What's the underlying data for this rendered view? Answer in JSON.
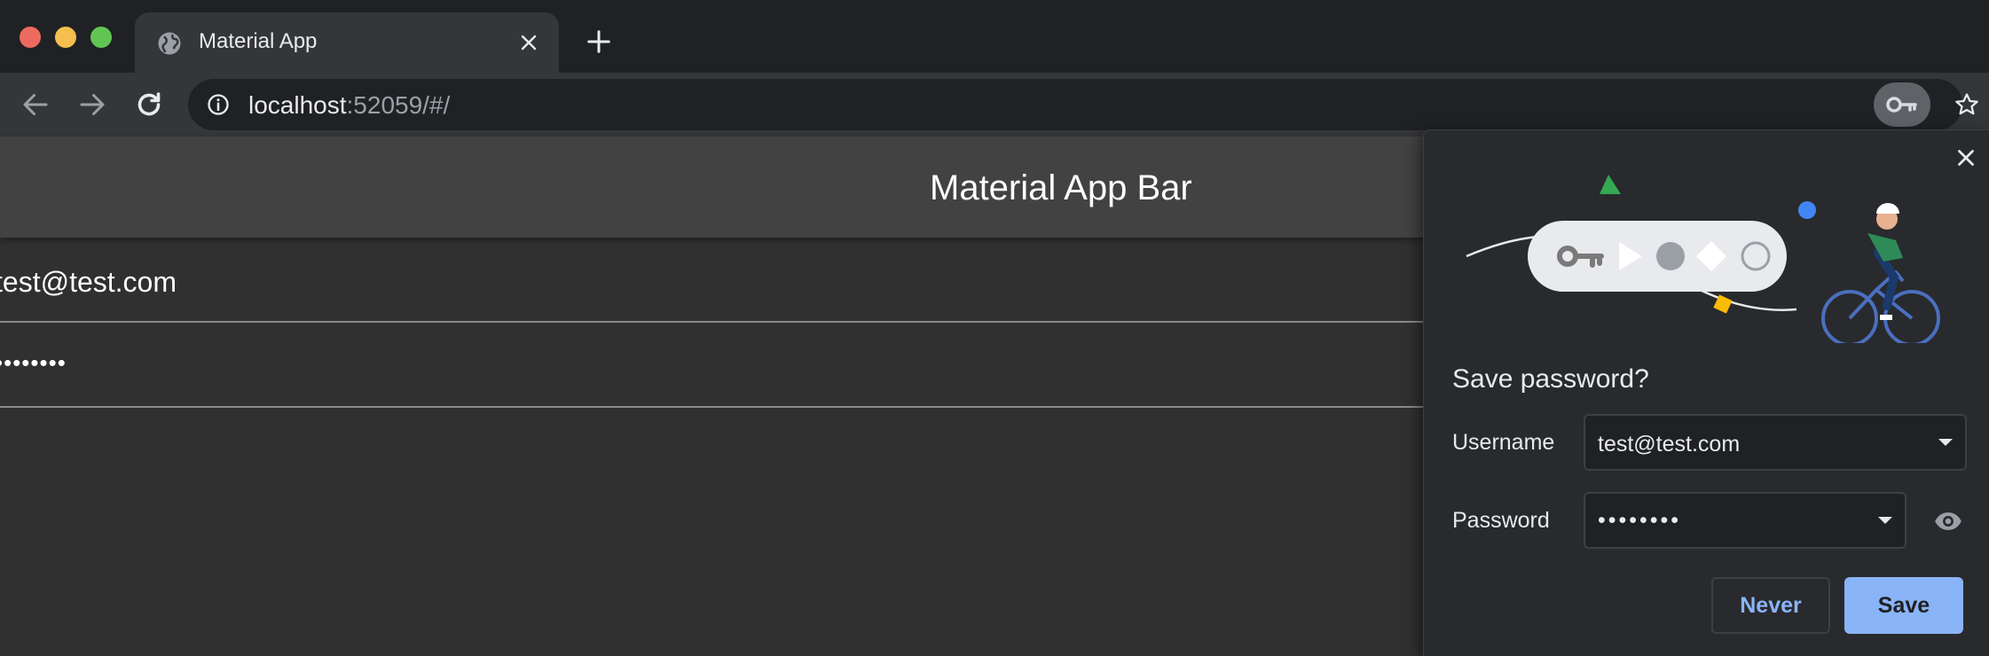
{
  "browser": {
    "tab": {
      "title": "Material App",
      "favicon": "globe-icon"
    },
    "new_tab_icon": "plus-icon",
    "nav": {
      "back_icon": "arrow-left-icon",
      "forward_icon": "arrow-right-icon",
      "reload_icon": "reload-icon"
    },
    "url": {
      "host": "localhost",
      "rest": ":52059/#/"
    },
    "password_key_icon": "key-icon",
    "bookmark_icon": "star-icon"
  },
  "app": {
    "appbar_title": "Material App Bar",
    "email_value": "test@test.com",
    "password_value": "••••••••"
  },
  "save_password_bubble": {
    "title": "Save password?",
    "username_label": "Username",
    "username_value": "test@test.com",
    "password_label": "Password",
    "password_value": "••••••••",
    "never_label": "Never",
    "save_label": "Save",
    "colors": {
      "accent": "#8ab4f8",
      "bubble_bg": "#292a2d"
    }
  }
}
